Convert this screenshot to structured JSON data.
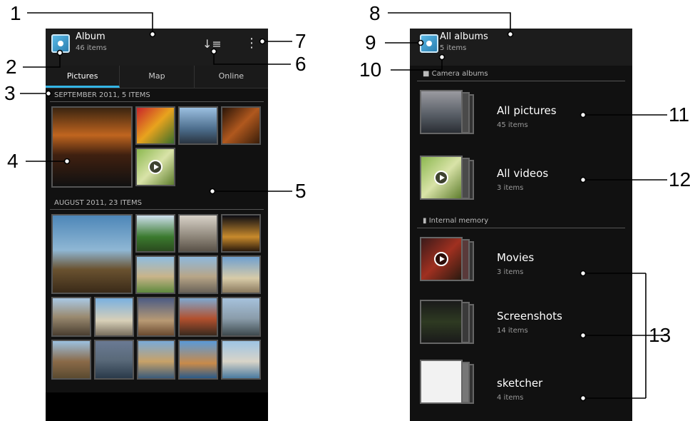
{
  "left_screen": {
    "action_bar": {
      "title": "Album",
      "subtitle": "46 items"
    },
    "tabs": [
      {
        "label": "Pictures",
        "active": true
      },
      {
        "label": "Map",
        "active": false
      },
      {
        "label": "Online",
        "active": false
      }
    ],
    "groups": [
      {
        "header": "SEPTEMBER 2011, 5 ITEMS"
      },
      {
        "header": "AUGUST 2011, 23 ITEMS"
      }
    ]
  },
  "right_screen": {
    "action_bar": {
      "title": "All albums",
      "subtitle": "5 items"
    },
    "sections": [
      {
        "label": "Camera albums"
      },
      {
        "label": "Internal memory"
      }
    ],
    "albums": [
      {
        "name": "All pictures",
        "count": "45 items"
      },
      {
        "name": "All videos",
        "count": "3 items"
      },
      {
        "name": "Movies",
        "count": "3 items"
      },
      {
        "name": "Screenshots",
        "count": "14 items"
      },
      {
        "name": "sketcher",
        "count": "4 items"
      }
    ]
  },
  "callouts": [
    "1",
    "2",
    "3",
    "4",
    "5",
    "6",
    "7",
    "8",
    "9",
    "10",
    "11",
    "12",
    "13"
  ],
  "colors": {
    "accent": "#33b5e5",
    "background": "#111111"
  }
}
